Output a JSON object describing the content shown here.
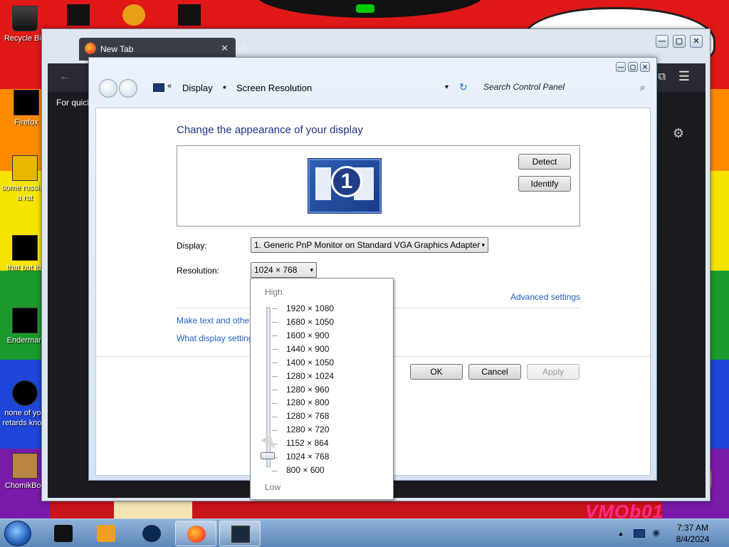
{
  "desktop": {
    "icons": [
      {
        "label": "Recycle Bin",
        "type": "bin"
      },
      {
        "label": "Firefox",
        "type": "app"
      },
      {
        "label": "some russian a rat",
        "type": "app"
      },
      {
        "label": "that but its",
        "type": "app"
      },
      {
        "label": "Enderman",
        "type": "app"
      },
      {
        "label": "none of you retards know",
        "type": "app"
      },
      {
        "label": "ChomikBox",
        "type": "app"
      }
    ],
    "watermark": "VMOb01"
  },
  "firefox": {
    "tab_title": "New Tab",
    "tab_close": "✕",
    "new_tab": "+",
    "quick_text": "For quick",
    "menu_icon": "☰",
    "ext_icon": "⧉",
    "gear_icon": "⚙",
    "back": "←"
  },
  "window_controls": {
    "minimize": "—",
    "maximize": "▢",
    "close": "✕"
  },
  "control_panel": {
    "breadcrumb_sep": "«",
    "crumb_display": "Display",
    "crumb_dot": "•",
    "crumb_resolution": "Screen Resolution",
    "dropdown_arrow": "▾",
    "refresh_icon": "↻",
    "search_placeholder": "Search Control Panel",
    "search_icon": "⌕",
    "heading": "Change the appearance of your display",
    "monitor_number": "1",
    "detect_label": "Detect",
    "identify_label": "Identify",
    "display_label": "Display:",
    "display_value": "1. Generic PnP Monitor on Standard VGA Graphics Adapter",
    "resolution_label": "Resolution:",
    "resolution_value": "1024 × 768",
    "advanced_link": "Advanced settings",
    "make_text_link": "Make text and other",
    "what_display_link": "What display setting",
    "ok_label": "OK",
    "cancel_label": "Cancel",
    "apply_label": "Apply"
  },
  "resolution_dropdown": {
    "high_label": "High",
    "low_label": "Low",
    "options": [
      "1920 × 1080",
      "1680 × 1050",
      "1600 × 900",
      "1440 × 900",
      "1400 × 1050",
      "1280 × 1024",
      "1280 × 960",
      "1280 × 800",
      "1280 × 768",
      "1280 × 720",
      "1152 × 864",
      "1024 × 768",
      "800 × 600"
    ],
    "selected": "1024 × 768"
  },
  "taskbar": {
    "time": "7:37 AM",
    "date": "8/4/2024",
    "show_hidden": "▲"
  }
}
